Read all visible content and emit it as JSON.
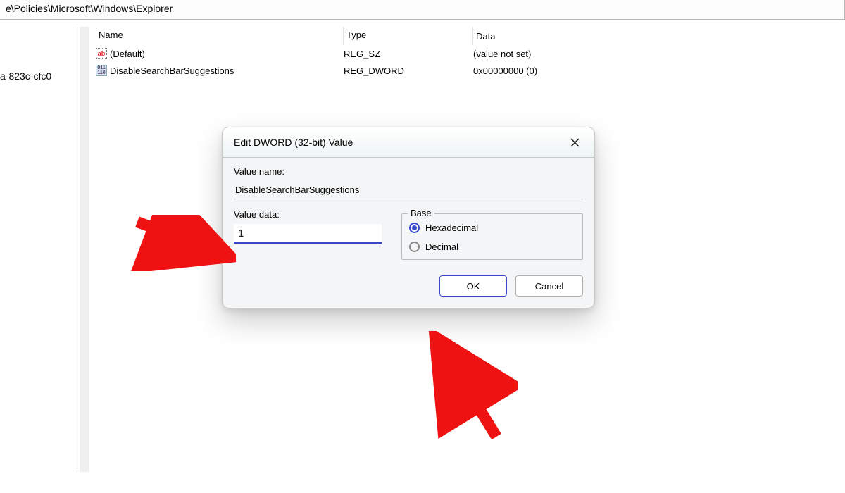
{
  "address_bar": "e\\Policies\\Microsoft\\Windows\\Explorer",
  "tree_fragment": "a-823c-cfc0",
  "columns": {
    "name": "Name",
    "type": "Type",
    "data": "Data"
  },
  "rows": [
    {
      "icon": "sz",
      "name": "(Default)",
      "type": "REG_SZ",
      "data": "(value not set)"
    },
    {
      "icon": "dw",
      "name": "DisableSearchBarSuggestions",
      "type": "REG_DWORD",
      "data": "0x00000000 (0)"
    }
  ],
  "dialog": {
    "title": "Edit DWORD (32-bit) Value",
    "value_name_label": "Value name:",
    "value_name": "DisableSearchBarSuggestions",
    "value_data_label": "Value data:",
    "value_data": "1",
    "base_label": "Base",
    "base_hex": "Hexadecimal",
    "base_dec": "Decimal",
    "ok": "OK",
    "cancel": "Cancel"
  }
}
